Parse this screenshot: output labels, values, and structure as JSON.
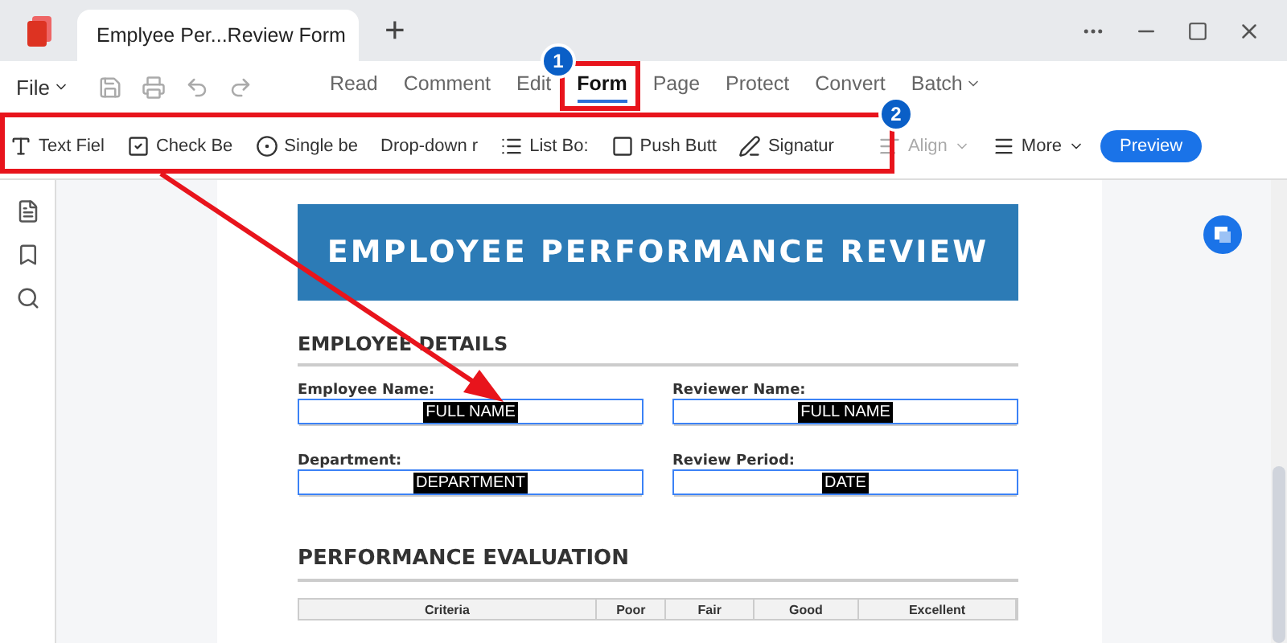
{
  "window": {
    "tab_title": "Emplyee Per...Review Form",
    "new_tab": "+"
  },
  "menu": {
    "file": "File",
    "tabs": [
      {
        "label": "Read",
        "selected": false
      },
      {
        "label": "Comment",
        "selected": false
      },
      {
        "label": "Edit",
        "selected": false
      },
      {
        "label": "Form",
        "selected": true
      },
      {
        "label": "Page",
        "selected": false
      },
      {
        "label": "Protect",
        "selected": false
      },
      {
        "label": "Convert",
        "selected": false
      },
      {
        "label": "Batch",
        "selected": false,
        "dropdown": true
      }
    ]
  },
  "toolbar": {
    "tools": [
      {
        "kind": "text",
        "label": "Text Fiel"
      },
      {
        "kind": "check",
        "label": "Check Bе"
      },
      {
        "kind": "radio",
        "label": "Single bе"
      },
      {
        "kind": "dropdown",
        "label": "Drop-down r"
      },
      {
        "kind": "list",
        "label": "List Bo:"
      },
      {
        "kind": "push",
        "label": "Push Butt"
      },
      {
        "kind": "signature",
        "label": "Signatur"
      }
    ],
    "align": {
      "label": "Align",
      "disabled": true
    },
    "more": {
      "label": "More"
    },
    "preview": "Preview"
  },
  "document": {
    "title": "EMPLOYEE PERFORMANCE REVIEW",
    "section1": "EMPLOYEE DETAILS",
    "fields": [
      {
        "label": "Employee Name:",
        "value": "FULL NAME"
      },
      {
        "label": "Reviewer Name:",
        "value": "FULL NAME"
      },
      {
        "label": "Department:",
        "value": "DEPARTMENT"
      },
      {
        "label": "Review Period:",
        "value": "DATE"
      }
    ],
    "section2": "PERFORMANCE EVALUATION",
    "table": {
      "columns": [
        "Criteria",
        "Poor",
        "Fair",
        "Good",
        "Excellent"
      ]
    }
  },
  "annotations": [
    {
      "kind": "badge",
      "label": "1"
    },
    {
      "kind": "badge",
      "label": "2"
    }
  ]
}
